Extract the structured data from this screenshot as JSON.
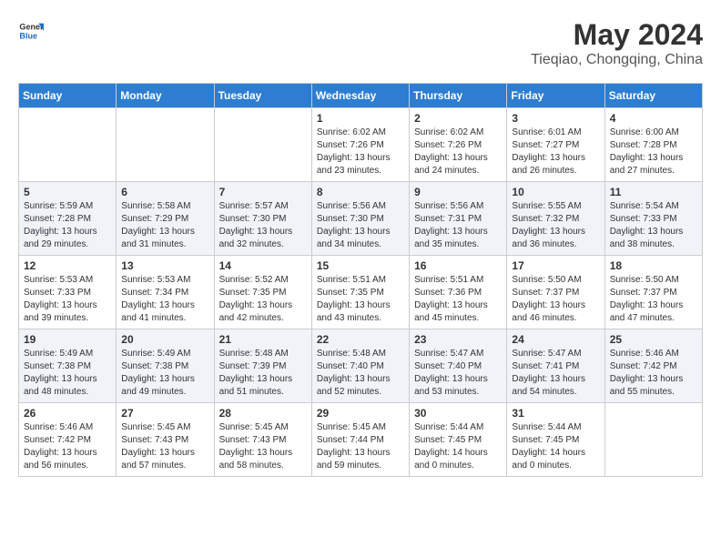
{
  "header": {
    "logo_line1": "General",
    "logo_line2": "Blue",
    "month_title": "May 2024",
    "location": "Tieqiao, Chongqing, China"
  },
  "weekdays": [
    "Sunday",
    "Monday",
    "Tuesday",
    "Wednesday",
    "Thursday",
    "Friday",
    "Saturday"
  ],
  "weeks": [
    [
      {
        "day": "",
        "sunrise": "",
        "sunset": "",
        "daylight": ""
      },
      {
        "day": "",
        "sunrise": "",
        "sunset": "",
        "daylight": ""
      },
      {
        "day": "",
        "sunrise": "",
        "sunset": "",
        "daylight": ""
      },
      {
        "day": "1",
        "sunrise": "Sunrise: 6:02 AM",
        "sunset": "Sunset: 7:26 PM",
        "daylight": "Daylight: 13 hours and 23 minutes."
      },
      {
        "day": "2",
        "sunrise": "Sunrise: 6:02 AM",
        "sunset": "Sunset: 7:26 PM",
        "daylight": "Daylight: 13 hours and 24 minutes."
      },
      {
        "day": "3",
        "sunrise": "Sunrise: 6:01 AM",
        "sunset": "Sunset: 7:27 PM",
        "daylight": "Daylight: 13 hours and 26 minutes."
      },
      {
        "day": "4",
        "sunrise": "Sunrise: 6:00 AM",
        "sunset": "Sunset: 7:28 PM",
        "daylight": "Daylight: 13 hours and 27 minutes."
      }
    ],
    [
      {
        "day": "5",
        "sunrise": "Sunrise: 5:59 AM",
        "sunset": "Sunset: 7:28 PM",
        "daylight": "Daylight: 13 hours and 29 minutes."
      },
      {
        "day": "6",
        "sunrise": "Sunrise: 5:58 AM",
        "sunset": "Sunset: 7:29 PM",
        "daylight": "Daylight: 13 hours and 31 minutes."
      },
      {
        "day": "7",
        "sunrise": "Sunrise: 5:57 AM",
        "sunset": "Sunset: 7:30 PM",
        "daylight": "Daylight: 13 hours and 32 minutes."
      },
      {
        "day": "8",
        "sunrise": "Sunrise: 5:56 AM",
        "sunset": "Sunset: 7:30 PM",
        "daylight": "Daylight: 13 hours and 34 minutes."
      },
      {
        "day": "9",
        "sunrise": "Sunrise: 5:56 AM",
        "sunset": "Sunset: 7:31 PM",
        "daylight": "Daylight: 13 hours and 35 minutes."
      },
      {
        "day": "10",
        "sunrise": "Sunrise: 5:55 AM",
        "sunset": "Sunset: 7:32 PM",
        "daylight": "Daylight: 13 hours and 36 minutes."
      },
      {
        "day": "11",
        "sunrise": "Sunrise: 5:54 AM",
        "sunset": "Sunset: 7:33 PM",
        "daylight": "Daylight: 13 hours and 38 minutes."
      }
    ],
    [
      {
        "day": "12",
        "sunrise": "Sunrise: 5:53 AM",
        "sunset": "Sunset: 7:33 PM",
        "daylight": "Daylight: 13 hours and 39 minutes."
      },
      {
        "day": "13",
        "sunrise": "Sunrise: 5:53 AM",
        "sunset": "Sunset: 7:34 PM",
        "daylight": "Daylight: 13 hours and 41 minutes."
      },
      {
        "day": "14",
        "sunrise": "Sunrise: 5:52 AM",
        "sunset": "Sunset: 7:35 PM",
        "daylight": "Daylight: 13 hours and 42 minutes."
      },
      {
        "day": "15",
        "sunrise": "Sunrise: 5:51 AM",
        "sunset": "Sunset: 7:35 PM",
        "daylight": "Daylight: 13 hours and 43 minutes."
      },
      {
        "day": "16",
        "sunrise": "Sunrise: 5:51 AM",
        "sunset": "Sunset: 7:36 PM",
        "daylight": "Daylight: 13 hours and 45 minutes."
      },
      {
        "day": "17",
        "sunrise": "Sunrise: 5:50 AM",
        "sunset": "Sunset: 7:37 PM",
        "daylight": "Daylight: 13 hours and 46 minutes."
      },
      {
        "day": "18",
        "sunrise": "Sunrise: 5:50 AM",
        "sunset": "Sunset: 7:37 PM",
        "daylight": "Daylight: 13 hours and 47 minutes."
      }
    ],
    [
      {
        "day": "19",
        "sunrise": "Sunrise: 5:49 AM",
        "sunset": "Sunset: 7:38 PM",
        "daylight": "Daylight: 13 hours and 48 minutes."
      },
      {
        "day": "20",
        "sunrise": "Sunrise: 5:49 AM",
        "sunset": "Sunset: 7:38 PM",
        "daylight": "Daylight: 13 hours and 49 minutes."
      },
      {
        "day": "21",
        "sunrise": "Sunrise: 5:48 AM",
        "sunset": "Sunset: 7:39 PM",
        "daylight": "Daylight: 13 hours and 51 minutes."
      },
      {
        "day": "22",
        "sunrise": "Sunrise: 5:48 AM",
        "sunset": "Sunset: 7:40 PM",
        "daylight": "Daylight: 13 hours and 52 minutes."
      },
      {
        "day": "23",
        "sunrise": "Sunrise: 5:47 AM",
        "sunset": "Sunset: 7:40 PM",
        "daylight": "Daylight: 13 hours and 53 minutes."
      },
      {
        "day": "24",
        "sunrise": "Sunrise: 5:47 AM",
        "sunset": "Sunset: 7:41 PM",
        "daylight": "Daylight: 13 hours and 54 minutes."
      },
      {
        "day": "25",
        "sunrise": "Sunrise: 5:46 AM",
        "sunset": "Sunset: 7:42 PM",
        "daylight": "Daylight: 13 hours and 55 minutes."
      }
    ],
    [
      {
        "day": "26",
        "sunrise": "Sunrise: 5:46 AM",
        "sunset": "Sunset: 7:42 PM",
        "daylight": "Daylight: 13 hours and 56 minutes."
      },
      {
        "day": "27",
        "sunrise": "Sunrise: 5:45 AM",
        "sunset": "Sunset: 7:43 PM",
        "daylight": "Daylight: 13 hours and 57 minutes."
      },
      {
        "day": "28",
        "sunrise": "Sunrise: 5:45 AM",
        "sunset": "Sunset: 7:43 PM",
        "daylight": "Daylight: 13 hours and 58 minutes."
      },
      {
        "day": "29",
        "sunrise": "Sunrise: 5:45 AM",
        "sunset": "Sunset: 7:44 PM",
        "daylight": "Daylight: 13 hours and 59 minutes."
      },
      {
        "day": "30",
        "sunrise": "Sunrise: 5:44 AM",
        "sunset": "Sunset: 7:45 PM",
        "daylight": "Daylight: 14 hours and 0 minutes."
      },
      {
        "day": "31",
        "sunrise": "Sunrise: 5:44 AM",
        "sunset": "Sunset: 7:45 PM",
        "daylight": "Daylight: 14 hours and 0 minutes."
      },
      {
        "day": "",
        "sunrise": "",
        "sunset": "",
        "daylight": ""
      }
    ]
  ]
}
